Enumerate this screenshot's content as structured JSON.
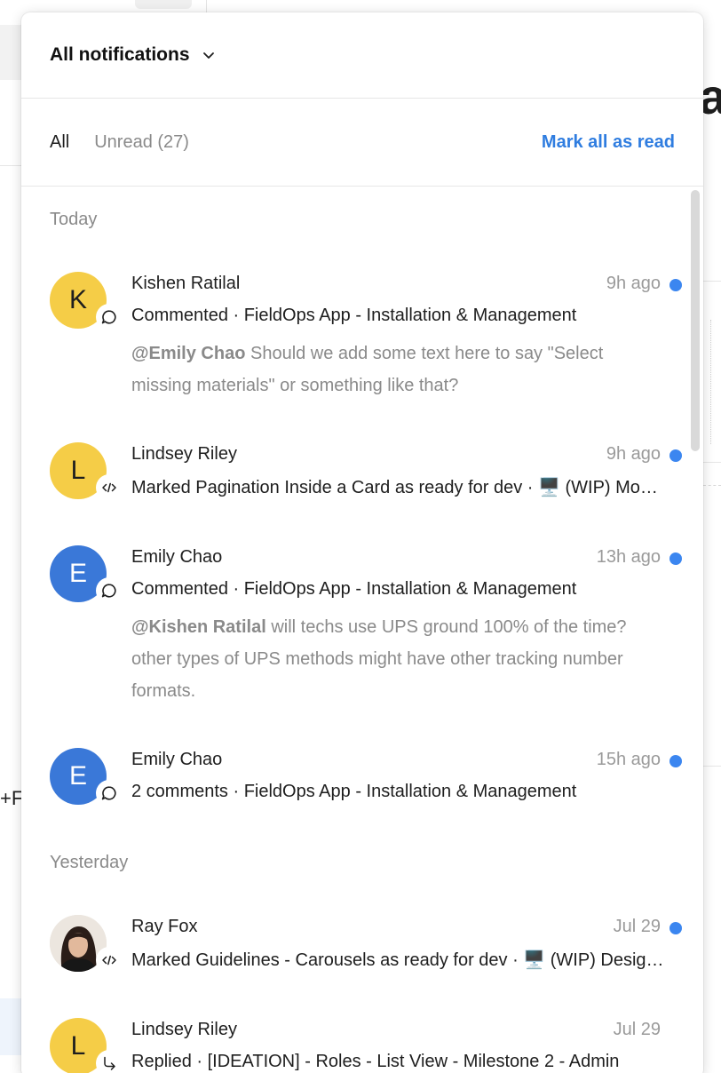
{
  "background": {
    "partial_heading": "al",
    "partial_text": "+F"
  },
  "header": {
    "title": "All notifications"
  },
  "tabs": {
    "all": "All",
    "unread": "Unread (27)",
    "mark_all_read": "Mark all as read"
  },
  "sections": {
    "today": "Today",
    "yesterday": "Yesterday"
  },
  "colors": {
    "accent": "#2f7de0",
    "unread_dot": "#3b86f0",
    "avatar_yellow": "#f5cd47",
    "avatar_blue": "#3a78d8"
  },
  "notifications": [
    {
      "initial": "K",
      "badge_icon": "comment-icon",
      "name": "Kishen Ratilal",
      "time": "9h ago",
      "unread": true,
      "action": "Commented · FieldOps App - Installation & Management",
      "mention": "@Emily Chao",
      "comment": " Should we add some text here to say \"Select missing materials\" or something like that?"
    },
    {
      "initial": "L",
      "badge_icon": "code-icon",
      "name": "Lindsey Riley",
      "time": "9h ago",
      "unread": true,
      "action": "Marked Pagination Inside a Card as ready for dev · 🖥️ (WIP) Mobile App - Technician Portal"
    },
    {
      "initial": "E",
      "badge_icon": "comment-icon",
      "name": "Emily Chao",
      "time": "13h ago",
      "unread": true,
      "action": "Commented · FieldOps App - Installation & Management",
      "mention": "@Kishen Ratilal",
      "comment": " will techs use UPS ground 100% of the time? other types of UPS methods might have other tracking number formats."
    },
    {
      "initial": "E",
      "badge_icon": "comment-icon",
      "name": "Emily Chao",
      "time": "15h ago",
      "unread": true,
      "action": "2 comments · FieldOps App - Installation & Management"
    },
    {
      "initial": "",
      "badge_icon": "code-icon",
      "name": "Ray Fox",
      "time": "Jul 29",
      "unread": true,
      "action": "Marked Guidelines - Carousels as ready for dev · 🖥️ (WIP) Design System"
    },
    {
      "initial": "L",
      "badge_icon": "reply-icon",
      "name": "Lindsey Riley",
      "time": "Jul 29",
      "unread": false,
      "action": "Replied · [IDEATION] - Roles - List View - Milestone 2 - Admin"
    }
  ]
}
